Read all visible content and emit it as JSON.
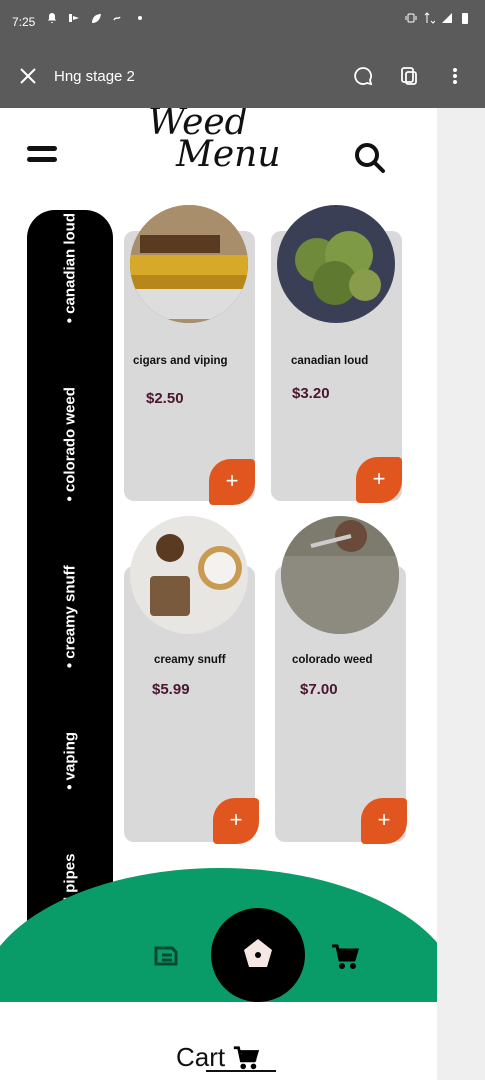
{
  "status_bar": {
    "time": "7:25",
    "left_icons": [
      "bell-icon",
      "cast-icon",
      "leaf-icon",
      "link-icon",
      "dot-icon"
    ],
    "right_icons": [
      "vibrate-icon",
      "lte-icon",
      "signal-icon",
      "battery-icon"
    ]
  },
  "toolbar": {
    "title": "Hng stage 2",
    "icons": [
      "close-icon",
      "chat-icon",
      "copy-icon",
      "more-icon"
    ]
  },
  "logo": {
    "line1": "Weed",
    "line2": "Menu"
  },
  "categories": [
    "• cigar and pipes",
    "• vaping",
    "• creamy snuff",
    "• colorado weed",
    "• canadian loud"
  ],
  "products": [
    {
      "name": "cigars and viping",
      "price": "$2.50",
      "add_label": "+"
    },
    {
      "name": "canadian loud",
      "price": "$3.20",
      "add_label": "+"
    },
    {
      "name": "creamy snuff",
      "price": "$5.99",
      "add_label": "+"
    },
    {
      "name": "colorado weed",
      "price": "$7.00",
      "add_label": "+"
    }
  ],
  "bottom_nav": {
    "items": [
      "coin-icon",
      "home-icon",
      "cart-icon"
    ],
    "cart_label": "Cart"
  },
  "colors": {
    "accent": "#e0561e",
    "green": "#0a9c68",
    "price": "#4a1630",
    "card": "#d9d9d9",
    "toolbar": "#5b5b5b"
  }
}
